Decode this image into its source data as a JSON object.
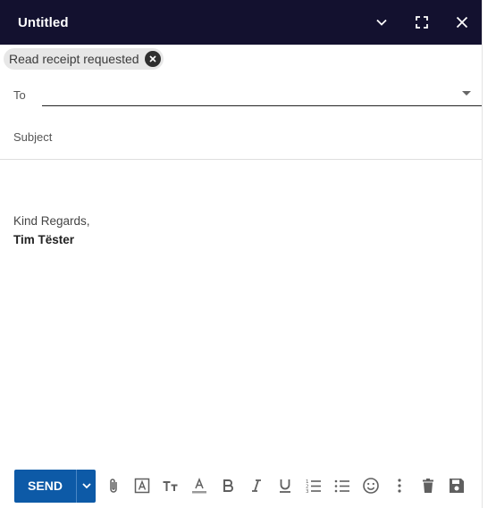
{
  "window": {
    "title": "Untitled",
    "controls": [
      "minimize-icon",
      "fullscreen-icon",
      "close-icon"
    ]
  },
  "chip": {
    "label": "Read receipt requested",
    "remove_icon": "remove-circle-icon"
  },
  "to": {
    "label": "To",
    "value": ""
  },
  "subject": {
    "placeholder": "Subject",
    "value": ""
  },
  "body": {
    "greeting": "Kind Regards,",
    "signature_name": "Tim Tëster"
  },
  "toolbar": {
    "send_label": "SEND",
    "tools": [
      "attach-icon",
      "text-box-icon",
      "font-size-icon",
      "text-color-icon",
      "bold-icon",
      "italic-icon",
      "underline-icon",
      "numbered-list-icon",
      "bulleted-list-icon",
      "emoji-icon",
      "more-options-icon",
      "delete-icon",
      "save-icon"
    ]
  },
  "colors": {
    "titlebar_bg": "#13112f",
    "send_button_bg": "#0d5aa7",
    "chip_bg": "#e7e7e7"
  }
}
